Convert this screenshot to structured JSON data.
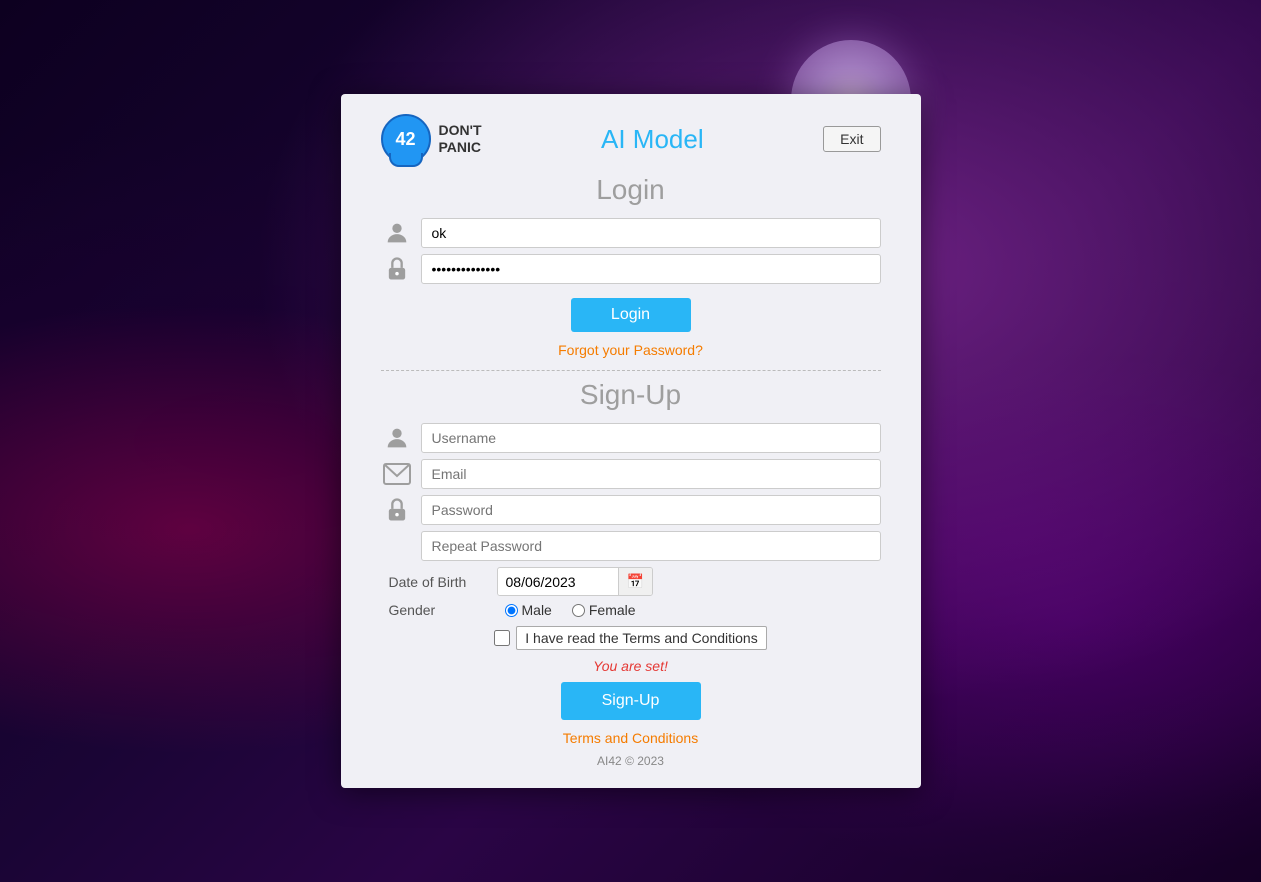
{
  "app": {
    "title": "AI Model",
    "logo_number": "42",
    "logo_text": "DON'T\nPANIC",
    "exit_label": "Exit"
  },
  "login_section": {
    "title": "Login",
    "username_value": "ok",
    "password_value": "••••••••••••••",
    "login_button": "Login",
    "forgot_password": "Forgot your Password?"
  },
  "signup_section": {
    "title": "Sign-Up",
    "username_placeholder": "Username",
    "email_placeholder": "Email",
    "password_placeholder": "Password",
    "repeat_password_placeholder": "Repeat Password",
    "date_label": "Date of Birth",
    "date_value": "08/06/2023",
    "gender_label": "Gender",
    "gender_options": [
      "Male",
      "Female"
    ],
    "selected_gender": "Male",
    "terms_text": "I have read the Terms and Conditions",
    "you_are_set": "You are set!",
    "signup_button": "Sign-Up",
    "terms_link": "Terms and Conditions",
    "footer": "AI42 © 2023"
  }
}
